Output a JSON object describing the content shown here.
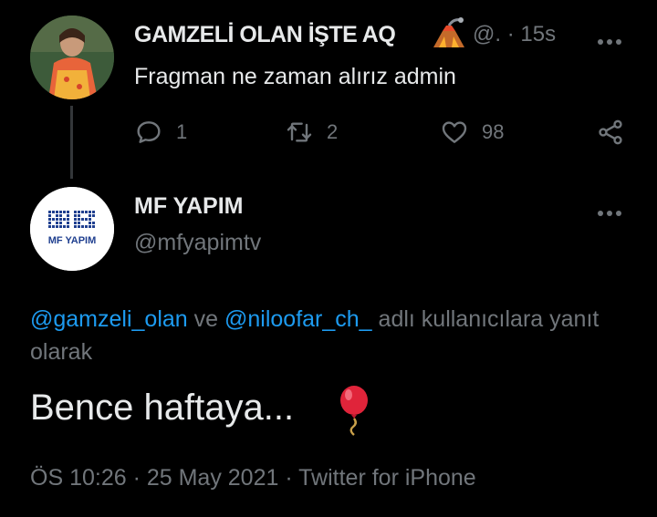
{
  "reply_to_tweet": {
    "display_name": "GAMZELİ OLAN İŞTE AQ",
    "name_emoji": "volcano-emoji",
    "handle": "@.",
    "separator": "·",
    "time": "15s",
    "text": "Fragman ne zaman alırız admin",
    "replies": "1",
    "retweets": "2",
    "likes": "98"
  },
  "tweet": {
    "display_name": "MF YAPIM",
    "handle": "@mfyapimtv",
    "avatar_logo_text": "MF YAPIM",
    "reply_context": {
      "mention1": "@gamzeli_olan",
      "conjunction": " ve ",
      "mention2": "@niloofar_ch_",
      "suffix": " adlı kullanıcılara yanıt olarak"
    },
    "text": "Bence haftaya...",
    "text_emoji": "balloon-emoji",
    "meta": "ÖS 10:26 · 25 May 2021 · Twitter for iPhone"
  },
  "colors": {
    "background": "#000000",
    "primary_text": "#e7e9ea",
    "secondary_text": "#71767b",
    "link": "#1d9bf0",
    "thread_line": "#333639"
  }
}
